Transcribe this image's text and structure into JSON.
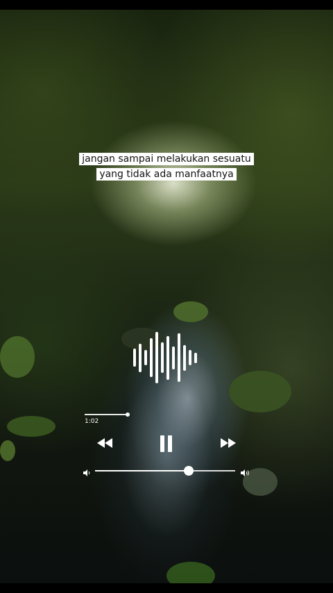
{
  "caption": {
    "line1": "jangan sampai melakukan sesuatu",
    "line2": "yang tidak ada manfaatnya"
  },
  "player": {
    "elapsed_time": "1:02",
    "progress_fraction": 0.9,
    "volume_fraction": 0.67,
    "icons": {
      "rewind": "rewind-icon",
      "pause": "pause-icon",
      "fast_forward": "fast-forward-icon",
      "volume_low": "volume-low-icon",
      "volume_high": "volume-high-icon",
      "waveform": "audio-waveform-icon"
    },
    "waveform_levels": [
      0.35,
      0.55,
      0.3,
      0.75,
      1.0,
      0.6,
      0.85,
      0.45,
      0.95,
      0.5,
      0.3,
      0.2
    ],
    "accent_color": "#ffffff"
  }
}
